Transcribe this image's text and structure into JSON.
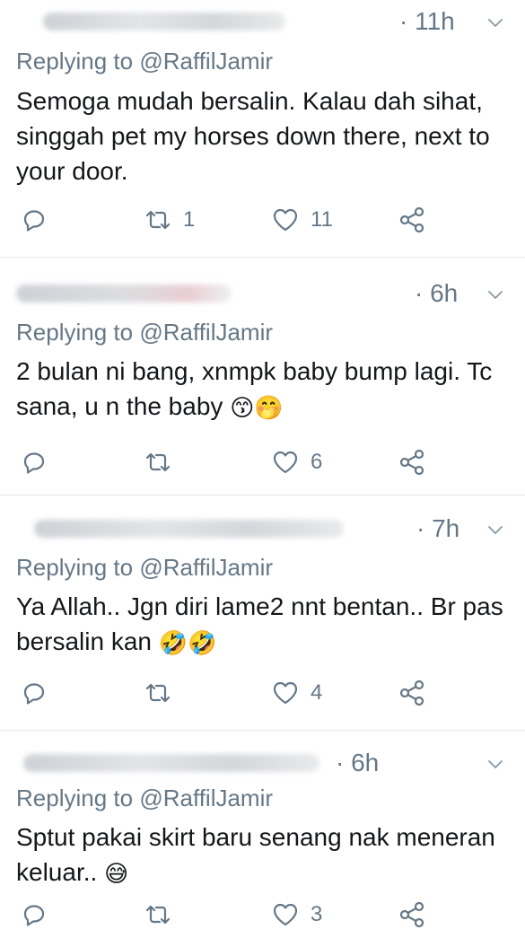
{
  "replies": [
    {
      "time": "· 11h",
      "reply_prefix": "Replying to ",
      "reply_handle": "@RaffilJamir",
      "text": "Semoga mudah bersalin. Kalau dah sihat, singgah pet my horses down there, next to your door.",
      "emojis": "",
      "retweets": "1",
      "likes": "11"
    },
    {
      "time": "· 6h",
      "reply_prefix": "Replying to ",
      "reply_handle": "@RaffilJamir",
      "text": "2 bulan ni bang, xnmpk baby bump lagi. Tc sana, u n the baby",
      "emojis": "😙🤭",
      "retweets": "",
      "likes": "6"
    },
    {
      "time": "· 7h",
      "reply_prefix": "Replying to ",
      "reply_handle": "@RaffilJamir",
      "text": "Ya Allah.. Jgn diri lame2 nnt bentan.. Br pas bersalin kan",
      "emojis": "🤣🤣",
      "retweets": "",
      "likes": "4"
    },
    {
      "time": "· 6h",
      "reply_prefix": "Replying to ",
      "reply_handle": "@RaffilJamir",
      "text": "Sptut pakai skirt baru senang nak meneran keluar..",
      "emojis": "😅",
      "retweets": "",
      "likes": "3"
    }
  ],
  "icons": {
    "reply": "reply-icon",
    "retweet": "retweet-icon",
    "like": "heart-icon",
    "share": "share-icon",
    "more": "chevron-down-icon"
  },
  "colors": {
    "muted": "#657786",
    "text": "#14171a",
    "divider": "#e1e8ed"
  }
}
